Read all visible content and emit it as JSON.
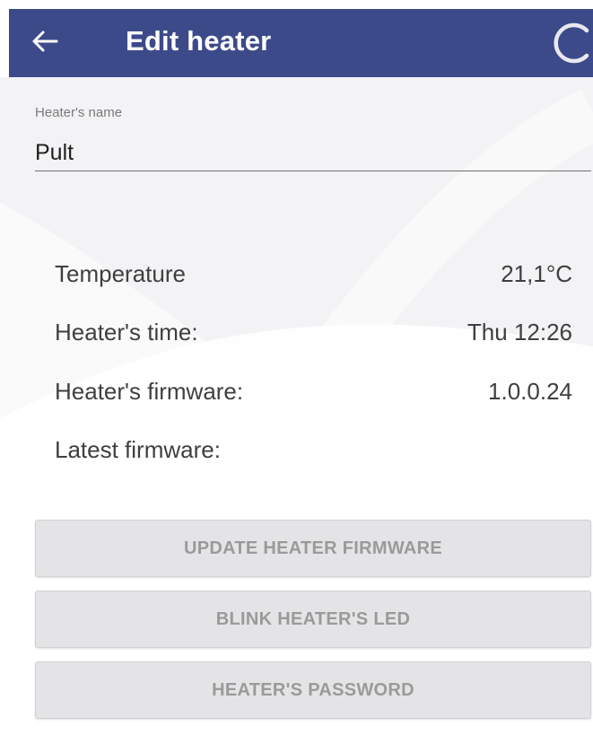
{
  "appbar": {
    "title": "Edit heater",
    "back_icon": "arrow-left-icon",
    "loading_icon": "spinner-icon",
    "color": "#3d4a8a"
  },
  "name_field": {
    "label": "Heater's name",
    "value": "Pult"
  },
  "info": {
    "temperature_label": "Temperature",
    "temperature_value": "21,1°C",
    "time_label": "Heater's time:",
    "time_value": "Thu 12:26",
    "firmware_label": "Heater's firmware:",
    "firmware_value": "1.0.0.24",
    "latest_firmware_label": "Latest firmware:",
    "latest_firmware_value": ""
  },
  "buttons": {
    "update_firmware": "UPDATE HEATER FIRMWARE",
    "blink_led": "BLINK HEATER'S LED",
    "password": "HEATER'S PASSWORD"
  }
}
